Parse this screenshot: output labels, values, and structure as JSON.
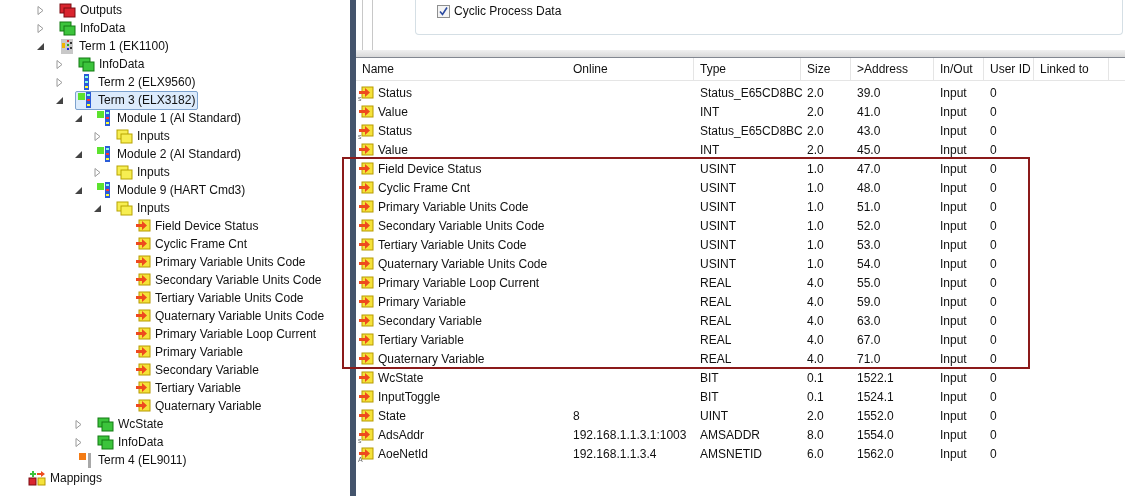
{
  "tree": {
    "items": [
      {
        "label": "Outputs",
        "kind": "red",
        "expanded": false,
        "selected": false
      },
      {
        "label": "InfoData",
        "kind": "green",
        "expanded": false,
        "selected": false
      },
      {
        "label": "Term 1 (EK1100)",
        "kind": "coupler",
        "expanded": true,
        "selected": false,
        "children": [
          {
            "label": "InfoData",
            "kind": "green",
            "expanded": false,
            "selected": false
          },
          {
            "label": "Term 2 (ELX9560)",
            "kind": "terminal",
            "expanded": false,
            "selected": false
          },
          {
            "label": "Term 3 (ELX3182)",
            "kind": "terminal_active",
            "expanded": true,
            "selected": true,
            "children": [
              {
                "label": "Module 1 (AI Standard)",
                "kind": "terminal_active",
                "expanded": true,
                "selected": false,
                "children": [
                  {
                    "label": "Inputs",
                    "kind": "yellow",
                    "expanded": false,
                    "selected": false
                  }
                ]
              },
              {
                "label": "Module 2 (AI Standard)",
                "kind": "terminal_active",
                "expanded": true,
                "selected": false,
                "children": [
                  {
                    "label": "Inputs",
                    "kind": "yellow",
                    "expanded": false,
                    "selected": false
                  }
                ]
              },
              {
                "label": "Module 9 (HART Cmd3)",
                "kind": "terminal_active",
                "expanded": true,
                "selected": false,
                "children": [
                  {
                    "label": "Inputs",
                    "kind": "yellow",
                    "expanded": true,
                    "selected": false,
                    "children": [
                      {
                        "label": "Field Device Status",
                        "kind": "var",
                        "selected": false
                      },
                      {
                        "label": "Cyclic Frame Cnt",
                        "kind": "var",
                        "selected": false
                      },
                      {
                        "label": "Primary Variable Units Code",
                        "kind": "var",
                        "selected": false
                      },
                      {
                        "label": "Secondary Variable Units Code",
                        "kind": "var",
                        "selected": false
                      },
                      {
                        "label": "Tertiary Variable Units Code",
                        "kind": "var",
                        "selected": false
                      },
                      {
                        "label": "Quaternary Variable Units Code",
                        "kind": "var",
                        "selected": false
                      },
                      {
                        "label": "Primary Variable Loop Current",
                        "kind": "var",
                        "selected": false
                      },
                      {
                        "label": "Primary Variable",
                        "kind": "var",
                        "selected": false
                      },
                      {
                        "label": "Secondary Variable",
                        "kind": "var",
                        "selected": false
                      },
                      {
                        "label": "Tertiary Variable",
                        "kind": "var",
                        "selected": false
                      },
                      {
                        "label": "Quaternary Variable",
                        "kind": "var",
                        "selected": false
                      }
                    ]
                  }
                ]
              },
              {
                "label": "WcState",
                "kind": "green",
                "expanded": false,
                "selected": false
              },
              {
                "label": "InfoData",
                "kind": "green",
                "expanded": false,
                "selected": false
              }
            ]
          },
          {
            "label": "Term 4 (EL9011)",
            "kind": "terminal_end",
            "selected": false
          }
        ]
      }
    ],
    "root": {
      "label": "Mappings",
      "kind": "mappings",
      "selected": false
    }
  },
  "settings": {
    "checkbox": {
      "label": "Cyclic Process Data",
      "checked": true
    }
  },
  "table": {
    "columns": [
      "Name",
      "Online",
      "Type",
      "Size",
      ">Address",
      "In/Out",
      "User ID",
      "Linked to"
    ],
    "rows": [
      {
        "cells": [
          "Status",
          "",
          "Status_E65CD8BC",
          "2.0",
          "39.0",
          "Input",
          "0",
          ""
        ],
        "badge": "s",
        "highlighted": false
      },
      {
        "cells": [
          "Value",
          "",
          "INT",
          "2.0",
          "41.0",
          "Input",
          "0",
          ""
        ],
        "highlighted": false
      },
      {
        "cells": [
          "Status",
          "",
          "Status_E65CD8BC",
          "2.0",
          "43.0",
          "Input",
          "0",
          ""
        ],
        "badge": "s",
        "highlighted": false
      },
      {
        "cells": [
          "Value",
          "",
          "INT",
          "2.0",
          "45.0",
          "Input",
          "0",
          ""
        ],
        "highlighted": false
      },
      {
        "cells": [
          "Field Device Status",
          "",
          "USINT",
          "1.0",
          "47.0",
          "Input",
          "0",
          ""
        ],
        "highlighted": true
      },
      {
        "cells": [
          "Cyclic Frame Cnt",
          "",
          "USINT",
          "1.0",
          "48.0",
          "Input",
          "0",
          ""
        ],
        "highlighted": true
      },
      {
        "cells": [
          "Primary Variable Units Code",
          "",
          "USINT",
          "1.0",
          "51.0",
          "Input",
          "0",
          ""
        ],
        "highlighted": true
      },
      {
        "cells": [
          "Secondary Variable Units Code",
          "",
          "USINT",
          "1.0",
          "52.0",
          "Input",
          "0",
          ""
        ],
        "highlighted": true
      },
      {
        "cells": [
          "Tertiary Variable Units Code",
          "",
          "USINT",
          "1.0",
          "53.0",
          "Input",
          "0",
          ""
        ],
        "highlighted": true
      },
      {
        "cells": [
          "Quaternary Variable Units Code",
          "",
          "USINT",
          "1.0",
          "54.0",
          "Input",
          "0",
          ""
        ],
        "highlighted": true
      },
      {
        "cells": [
          "Primary Variable Loop Current",
          "",
          "REAL",
          "4.0",
          "55.0",
          "Input",
          "0",
          ""
        ],
        "highlighted": true
      },
      {
        "cells": [
          "Primary Variable",
          "",
          "REAL",
          "4.0",
          "59.0",
          "Input",
          "0",
          ""
        ],
        "highlighted": true
      },
      {
        "cells": [
          "Secondary Variable",
          "",
          "REAL",
          "4.0",
          "63.0",
          "Input",
          "0",
          ""
        ],
        "highlighted": true
      },
      {
        "cells": [
          "Tertiary Variable",
          "",
          "REAL",
          "4.0",
          "67.0",
          "Input",
          "0",
          ""
        ],
        "highlighted": true
      },
      {
        "cells": [
          "Quaternary Variable",
          "",
          "REAL",
          "4.0",
          "71.0",
          "Input",
          "0",
          ""
        ],
        "highlighted": true
      },
      {
        "cells": [
          "WcState",
          "",
          "BIT",
          "0.1",
          "1522.1",
          "Input",
          "0",
          ""
        ],
        "highlighted": false
      },
      {
        "cells": [
          "InputToggle",
          "",
          "BIT",
          "0.1",
          "1524.1",
          "Input",
          "0",
          ""
        ],
        "highlighted": false
      },
      {
        "cells": [
          "State",
          "8",
          "UINT",
          "2.0",
          "1552.0",
          "Input",
          "0",
          ""
        ],
        "highlighted": false
      },
      {
        "cells": [
          "AdsAddr",
          "192.168.1.1.3.1:1003",
          "AMSADDR",
          "8.0",
          "1554.0",
          "Input",
          "0",
          ""
        ],
        "badge": "s",
        "highlighted": false
      },
      {
        "cells": [
          "AoeNetId",
          "192.168.1.1.3.4",
          "AMSNETID",
          "6.0",
          "1562.0",
          "Input",
          "0",
          ""
        ],
        "badge": "A",
        "highlighted": false
      }
    ]
  }
}
